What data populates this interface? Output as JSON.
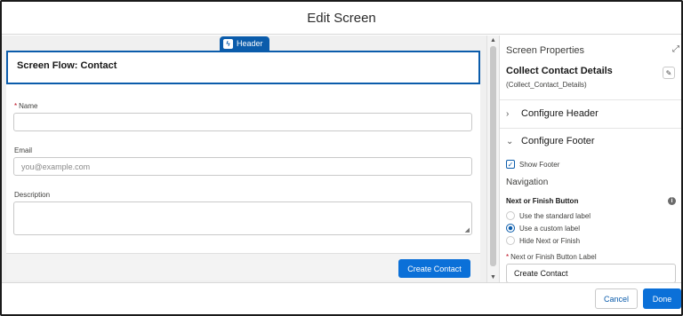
{
  "window": {
    "title": "Edit Screen"
  },
  "canvas": {
    "header_tag": "Header",
    "screen_header": "Screen Flow: Contact",
    "fields": [
      {
        "label": "Name",
        "required": "*",
        "value": "",
        "placeholder": ""
      },
      {
        "label": "Email",
        "placeholder": "you@example.com"
      },
      {
        "label": "Description",
        "value": ""
      }
    ],
    "footer_button": "Create Contact"
  },
  "panel": {
    "title": "Screen Properties",
    "screen_label": "Collect Contact Details",
    "screen_api_name": "(Collect_Contact_Details)",
    "sections": [
      {
        "label": "Configure Header",
        "expanded": false
      },
      {
        "label": "Configure Footer",
        "expanded": true
      }
    ],
    "show_footer": {
      "label": "Show Footer",
      "checked": true
    },
    "navigation_heading": "Navigation",
    "next_finish": {
      "label": "Next or Finish Button",
      "options": [
        {
          "label": "Use the standard label",
          "selected": false
        },
        {
          "label": "Use a custom label",
          "selected": true
        },
        {
          "label": "Hide Next or Finish",
          "selected": false
        }
      ],
      "custom_label_field": {
        "required": "*",
        "label": "Next or Finish Button Label",
        "value": "Create Contact"
      }
    }
  },
  "actions": {
    "cancel": "Cancel",
    "done": "Done"
  },
  "colors": {
    "brand": "#0b70d8",
    "brand_dark": "#0b5cab",
    "required": "#ba0517"
  },
  "icons": [
    "lightning-icon",
    "expand-icon",
    "edit-icon",
    "chevron-right-icon",
    "chevron-down-icon",
    "check-icon",
    "info-icon",
    "resize-grip-icon",
    "scroll-up-icon",
    "scroll-down-icon"
  ]
}
